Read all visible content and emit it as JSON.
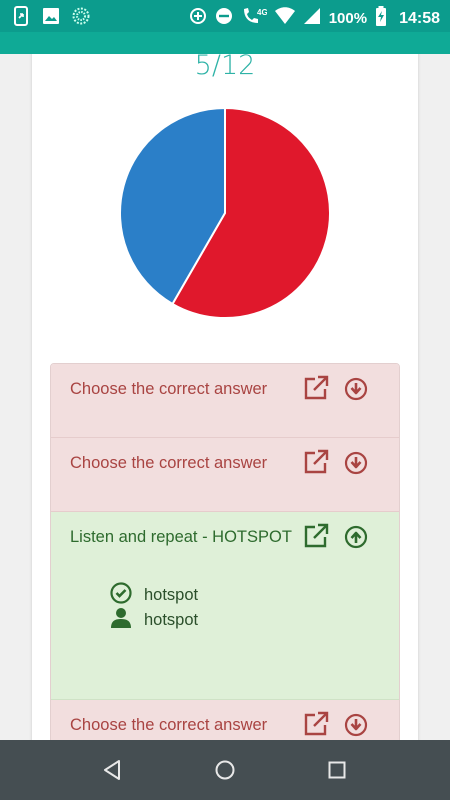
{
  "status_bar": {
    "battery_percent": "100%",
    "time": "14:58",
    "network": "4G",
    "left_icons": [
      "screen-share-icon",
      "image-icon",
      "sync-circle-icon"
    ],
    "right_icons": [
      "data-saver-icon",
      "do-not-disturb-icon",
      "wifi-calling-icon",
      "wifi-icon",
      "signal-icon",
      "battery-charging-icon"
    ]
  },
  "score": {
    "text": "5/12",
    "color": "#2fb3a7"
  },
  "chart_data": {
    "type": "pie",
    "values": [
      7,
      5
    ],
    "colors": [
      "#e0182c",
      "#2b7fc8"
    ]
  },
  "answers": [
    {
      "title": "Choose the correct answer",
      "state": "wrong",
      "expanded": false,
      "open_icon": "external-link-icon",
      "toggle_icon": "arrow-circle-down-icon"
    },
    {
      "title": "Choose the correct answer",
      "state": "wrong",
      "expanded": false,
      "open_icon": "external-link-icon",
      "toggle_icon": "arrow-circle-down-icon"
    },
    {
      "title": "Listen and repeat - HOTSPOT",
      "state": "correct",
      "expanded": true,
      "open_icon": "external-link-icon",
      "toggle_icon": "arrow-circle-up-icon",
      "details": [
        {
          "icon": "check-circle-icon",
          "text": "hotspot"
        },
        {
          "icon": "user-icon",
          "text": "hotspot"
        }
      ]
    },
    {
      "title": "Choose the correct answer",
      "state": "wrong",
      "expanded": false,
      "open_icon": "external-link-icon",
      "toggle_icon": "arrow-circle-down-icon"
    }
  ],
  "colors": {
    "wrong_bg": "#f2dede",
    "wrong_text": "#a94442",
    "correct_bg": "#dff0d8",
    "correct_text": "#2e6b2e",
    "header": "#0c9c8d"
  },
  "nav_bar": {
    "buttons": [
      "back-icon",
      "home-icon",
      "recents-icon"
    ]
  }
}
